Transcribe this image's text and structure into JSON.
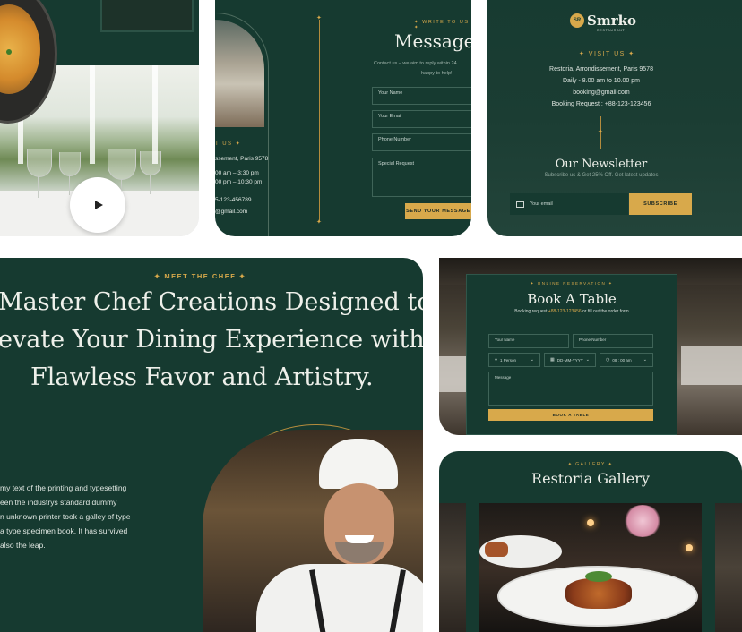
{
  "video_card": {
    "play_label": "play"
  },
  "contact_card": {
    "eyebrow": "✦ WRITE TO US ✦",
    "heading": "Message u",
    "subtext": [
      "Contact us – we aim to reply within 24",
      "happy to help!"
    ],
    "info_eyebrow": "T US ✦",
    "info_lines": [
      "ssement, Paris 9578",
      "00 am – 3:30 pm",
      "00 pm – 10:30 pm",
      "5-123-456789",
      "@gmail.com"
    ],
    "fields": {
      "name": "Your Name",
      "email": "Your Email",
      "phone": "Phone Number",
      "request": "Special Request"
    },
    "submit": "SEND YOUR MESSAGE"
  },
  "footer_card": {
    "logo_monogram": "SR",
    "brand": "Smrko",
    "brand_sub": "RESTAURANT",
    "eyebrow": "✦ VISIT US ✦",
    "lines": [
      "Restoria, Arrondissement, Paris 9578",
      "Daily - 8.00 am to 10.00 pm",
      "booking@gmail.com",
      "Booking Request : +88-123-123456"
    ],
    "newsletter_title": "Our Newsletter",
    "newsletter_sub": "Subscribe us & Get 25% Off. Get latest updates",
    "email_placeholder": "Your email",
    "subscribe": "SUBSCRIBE"
  },
  "chef_card": {
    "eyebrow": "✦ MEET THE CHEF ✦",
    "heading_lines": [
      "Master Chef Creations Designed to",
      "evate Your Dining Experience with",
      "Flawless Favor and Artistry."
    ],
    "body_lines": [
      "my text of the printing and typesetting",
      "een the industrys standard dummy",
      "n unknown printer took a galley of type",
      "a type specimen book. It has survived",
      "also the leap."
    ]
  },
  "booking_card": {
    "eyebrow": "✦ ONLINE RESERVATION ✦",
    "title": "Book A Table",
    "sub_prefix": "Booking request",
    "sub_phone": "+88-123-123456",
    "sub_suffix": "or fill out the order form",
    "name": "Your Name",
    "phone": "Phone Number",
    "person": "1 Person",
    "date": "DD-MM-YYYY",
    "time": "08 : 00 am",
    "message": "Message",
    "submit": "BOOK A TABLE"
  },
  "gallery_card": {
    "eyebrow": "✦ GALLERY ✦",
    "title": "Restoria Gallery"
  },
  "colors": {
    "background": "#163a30",
    "accent": "#d8a94b",
    "text": "#eef0ea"
  }
}
